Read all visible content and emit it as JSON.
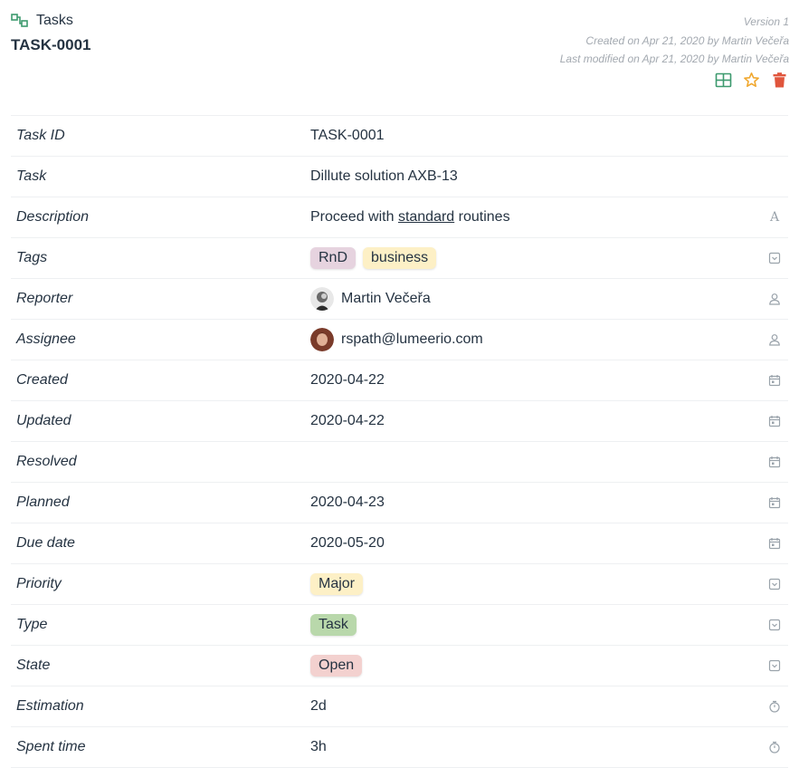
{
  "header": {
    "collection_name": "Tasks",
    "record_title": "TASK-0001",
    "version": "Version 1",
    "created_meta": "Created on Apr 21, 2020 by Martin Večeřa",
    "modified_meta": "Last modified on Apr 21, 2020 by Martin Večeřa",
    "icons": [
      "table-icon",
      "star-icon",
      "trash-icon"
    ]
  },
  "colors": {
    "tag_rnd": "#e6d3df",
    "tag_business": "#fdf0c6",
    "tag_major": "#fdf0c6",
    "tag_task": "#b9d8ab",
    "tag_open": "#f3d1cf",
    "collection_icon": "#3d9a6e",
    "star": "#f0a830",
    "trash": "#e0553c",
    "table_icon": "#3d9a6e"
  },
  "fields": {
    "task_id": {
      "label": "Task ID",
      "value": "TASK-0001"
    },
    "task": {
      "label": "Task",
      "value": "Dillute solution AXB-13"
    },
    "description": {
      "label": "Description",
      "prefix": "Proceed with ",
      "link": "standard",
      "suffix": " routines",
      "type_icon": "text-icon",
      "type_glyph": "A"
    },
    "tags": {
      "label": "Tags",
      "values": [
        "RnD",
        "business"
      ],
      "type_icon": "select-icon"
    },
    "reporter": {
      "label": "Reporter",
      "value": "Martin Večeřa",
      "type_icon": "user-icon"
    },
    "assignee": {
      "label": "Assignee",
      "value": "rspath@lumeerio.com",
      "type_icon": "user-icon"
    },
    "created": {
      "label": "Created",
      "value": "2020-04-22",
      "type_icon": "calendar-icon"
    },
    "updated": {
      "label": "Updated",
      "value": "2020-04-22",
      "type_icon": "calendar-icon"
    },
    "resolved": {
      "label": "Resolved",
      "value": "",
      "type_icon": "calendar-icon"
    },
    "planned": {
      "label": "Planned",
      "value": "2020-04-23",
      "type_icon": "calendar-icon"
    },
    "due_date": {
      "label": "Due date",
      "value": "2020-05-20",
      "type_icon": "calendar-icon"
    },
    "priority": {
      "label": "Priority",
      "value": "Major",
      "type_icon": "select-icon"
    },
    "type": {
      "label": "Type",
      "value": "Task",
      "type_icon": "select-icon"
    },
    "state": {
      "label": "State",
      "value": "Open",
      "type_icon": "select-icon"
    },
    "estimation": {
      "label": "Estimation",
      "value": "2d",
      "type_icon": "stopwatch-icon"
    },
    "spent_time": {
      "label": "Spent time",
      "value": "3h",
      "type_icon": "stopwatch-icon"
    }
  }
}
